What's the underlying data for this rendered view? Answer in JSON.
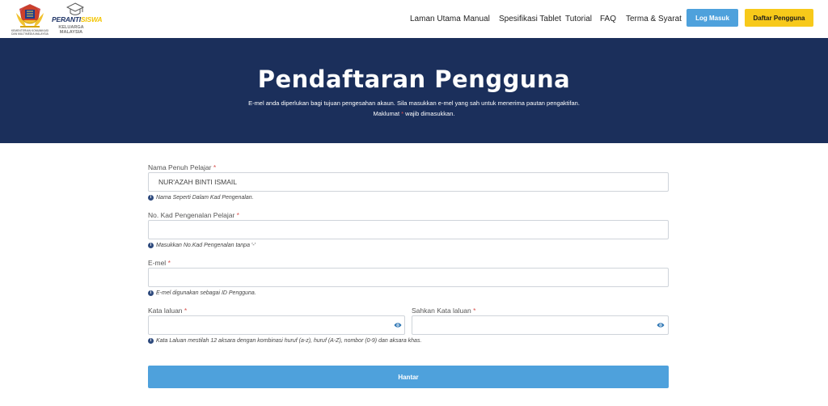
{
  "header": {
    "gov_logo_caption": "KEMENTERIAN KOMUNIKASI DAN MULTIMEDIA MALAYSIA",
    "brand_name_part1": "PERANTI",
    "brand_name_part2": "SISWA",
    "brand_sub": "KELUARGA MALAYSIA",
    "nav": [
      "Laman Utama",
      "Manual",
      "Spesifikasi Tablet",
      "Tutorial",
      "FAQ",
      "Terma & Syarat"
    ],
    "login_label": "Log Masuk",
    "register_label": "Daftar Pengguna"
  },
  "hero": {
    "title": "Pendaftaran Pengguna",
    "description": "E-mel anda diperlukan bagi tujuan pengesahan akaun. Sila masukkan e-mel yang sah untuk menerima pautan pengaktifan.",
    "note_before": "Maklumat",
    "note_star": "*",
    "note_after": "wajib dimasukkan."
  },
  "form": {
    "required_mark": "*",
    "info_icon_glyph": "i",
    "full_name": {
      "label": "Nama Penuh Pelajar",
      "value": "NUR'AZAH BINTI ISMAIL",
      "hint": "Nama Seperti Dalam Kad Pengenalan."
    },
    "ic_number": {
      "label": "No. Kad Pengenalan Pelajar",
      "value": "",
      "hint": "Masukkan No.Kad Pengenalan tanpa '-'"
    },
    "email": {
      "label": "E-mel",
      "value": "",
      "hint": "E-mel digunakan sebagai ID Pengguna."
    },
    "password": {
      "label": "Kata laluan",
      "value": ""
    },
    "confirm_password": {
      "label": "Sahkan Kata laluan",
      "value": ""
    },
    "password_hint": "Kata Laluan mestilah 12 aksara dengan kombinasi huruf (a-z), huruf (A-Z), nombor (0-9) dan aksara khas.",
    "submit_label": "Hantar"
  },
  "colors": {
    "hero_bg": "#1b2f5b",
    "primary_button": "#4ea1dc",
    "register_button": "#f7c91a",
    "required": "#d9534f"
  },
  "icons": [
    "government-crest-icon",
    "graduation-cap-icon",
    "info-icon",
    "eye-icon"
  ]
}
